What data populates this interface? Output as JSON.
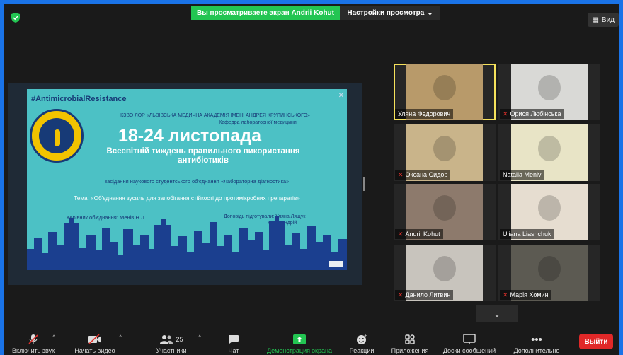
{
  "top_bar": {
    "banner": "Вы просматриваете экран Andrii Kohut",
    "view_settings": "Настройки просмотра",
    "view_button": "Вид"
  },
  "slide": {
    "hashtag": "#AntimicrobialResistance",
    "organization": "КЗВО ЛОР «ЛЬВІВСЬКА МЕДИЧНА АКАДЕМІЯ ІМЕНІ АНДРЕЯ КРУПИНСЬКОГО»",
    "department": "Кафедра лабораторної медицини",
    "dates": "18-24 листопада",
    "week_line1": "Всесвітній тиждень правильного використання",
    "week_line2": "антибіотиків",
    "meeting": "засідання наукового студентського об'єднання «Лабораторна діагностика»",
    "topic": "Тема: «Об'єднання зусиль для запобігання стійкості до протимікробних препаратів»",
    "leader": "Керівник об'єднання: Менів Н.Л.",
    "prepared_by": "Доповідь підготували: Уляна Лящук",
    "prepared_by2": "Когут Андрій",
    "logo_text": "ЛЬВІВСЬКА МЕДИЧНА АКАДЕМІЯ ІМ АНДРЕЯ КРУПИНСЬКОГО"
  },
  "participants": [
    {
      "name": "Уляна Федорович",
      "muted": false,
      "active": true,
      "bg": "#b89a6a"
    },
    {
      "name": "Орися Любінська",
      "muted": true,
      "active": false,
      "bg": "#d9d9d6"
    },
    {
      "name": "Оксана Сидор",
      "muted": true,
      "active": false,
      "bg": "#c9b48a"
    },
    {
      "name": "Natalia Meniv",
      "muted": false,
      "active": false,
      "bg": "#e8e4c6"
    },
    {
      "name": "Andrii Kohut",
      "muted": true,
      "active": false,
      "bg": "#8d7a6c"
    },
    {
      "name": "Uliana Liashchuk",
      "muted": false,
      "active": false,
      "bg": "#e6ddd0"
    },
    {
      "name": "Данило Литвин",
      "muted": true,
      "active": false,
      "bg": "#c8c4bd"
    },
    {
      "name": "Марія Хомин",
      "muted": true,
      "active": false,
      "bg": "#5c5a52"
    }
  ],
  "toolbar": {
    "mute": "Включить звук",
    "video": "Начать видео",
    "participants": "Участники",
    "participants_count": "25",
    "chat": "Чат",
    "share": "Демонстрация экрана",
    "reactions": "Реакции",
    "apps": "Приложения",
    "whiteboards": "Доски сообщений",
    "more": "Дополнительно",
    "leave": "Выйти"
  },
  "colors": {
    "share_green": "#23c552",
    "leave_red": "#e02828",
    "slide_teal": "#4cc1c5",
    "active_speaker": "#f5e15b"
  }
}
